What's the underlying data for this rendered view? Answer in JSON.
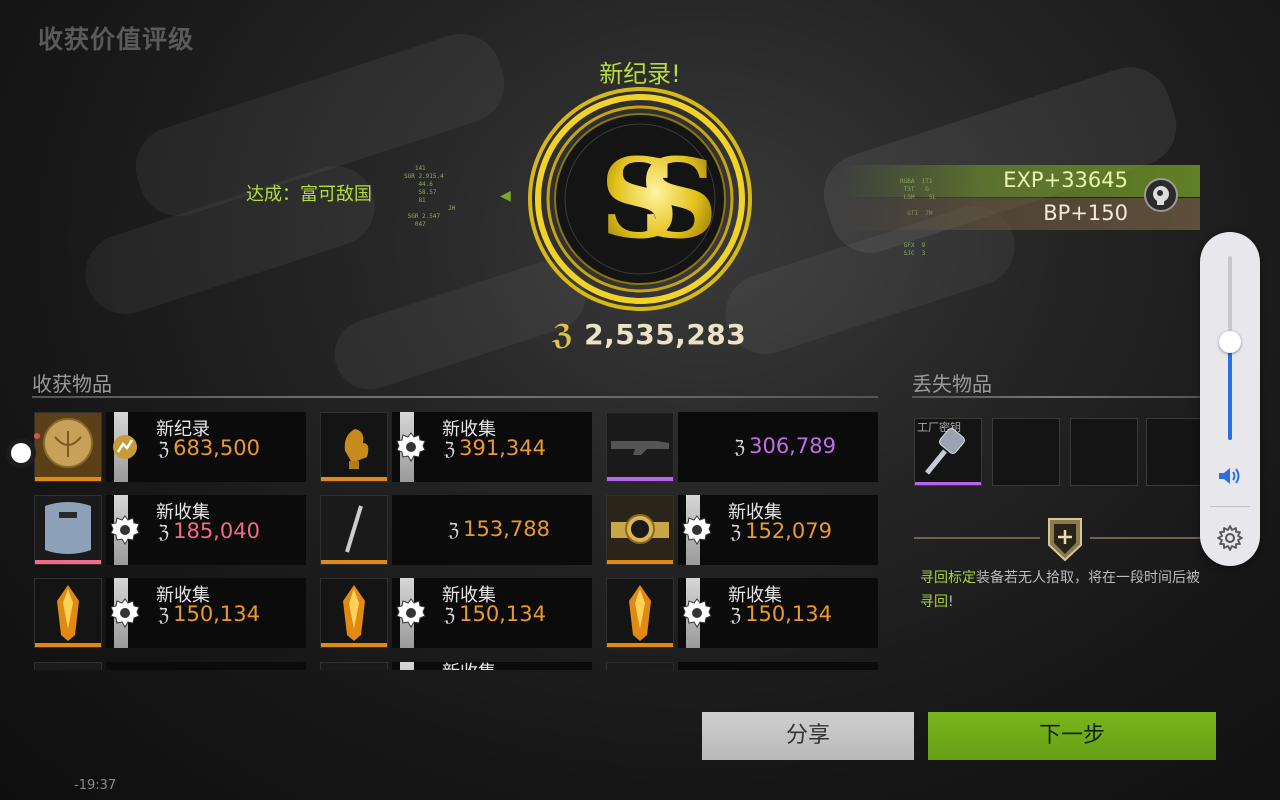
{
  "page_title": "收获价值评级",
  "record_label": "新纪录!",
  "achieve": {
    "prefix": "达成：",
    "value": "富可敌国"
  },
  "rank_badge": "SS",
  "total_value": "2,535,283",
  "rewards": {
    "exp": "EXP+33645",
    "bp": "BP+150"
  },
  "hud": {
    "left": "   141\nSGR 2.915.4\n    44.6\n    58.57\n    81\n\n SGR 2.547\n   047",
    "left_small": "JH",
    "right": "RGBA  1T1\n T3T   G\n LGM    5L\n\n  GTI  7M\n\n\n\n GFX  9\n SJC  3"
  },
  "harvest": {
    "title": "收获物品",
    "items": [
      {
        "label": "新纪录",
        "price": "683,500",
        "color": "orange",
        "thumb": "gold-medal-icon",
        "tag": "record"
      },
      {
        "label": "新收集",
        "price": "391,344",
        "color": "orange",
        "thumb": "golden-rooster-icon",
        "tag": "new"
      },
      {
        "label": "",
        "price": "306,789",
        "color": "purple",
        "thumb": "rifle-icon",
        "tag": ""
      },
      {
        "label": "新收集",
        "price": "185,040",
        "color": "pink",
        "thumb": "armor-plate-icon",
        "tag": "new"
      },
      {
        "label": "",
        "price": "153,788",
        "color": "orange",
        "thumb": "pen-icon",
        "tag": ""
      },
      {
        "label": "新收集",
        "price": "152,079",
        "color": "orange",
        "thumb": "gold-watch-icon",
        "tag": "new"
      },
      {
        "label": "新收集",
        "price": "150,134",
        "color": "orange",
        "thumb": "crystal-icon",
        "tag": "new"
      },
      {
        "label": "新收集",
        "price": "150,134",
        "color": "orange",
        "thumb": "crystal-icon",
        "tag": "new"
      },
      {
        "label": "新收集",
        "price": "150,134",
        "color": "orange",
        "thumb": "crystal-icon",
        "tag": "new"
      }
    ],
    "partial_row_label": "新收集"
  },
  "lost": {
    "title": "丢失物品",
    "slot_tag": "工厂密钥",
    "notice_hl1": "寻回标定",
    "notice_mid": "装备若无人拾取，将在一段时间后被",
    "notice_hl2": "寻回",
    "notice_end": "!"
  },
  "buttons": {
    "share": "分享",
    "next": "下一步"
  },
  "clock": "-19:37",
  "volume_level": 0.53,
  "colors": {
    "accent_green": "#b6dd3b",
    "orange": "#e99a2a",
    "pink": "#f26a8a",
    "purple": "#c26ee8"
  }
}
